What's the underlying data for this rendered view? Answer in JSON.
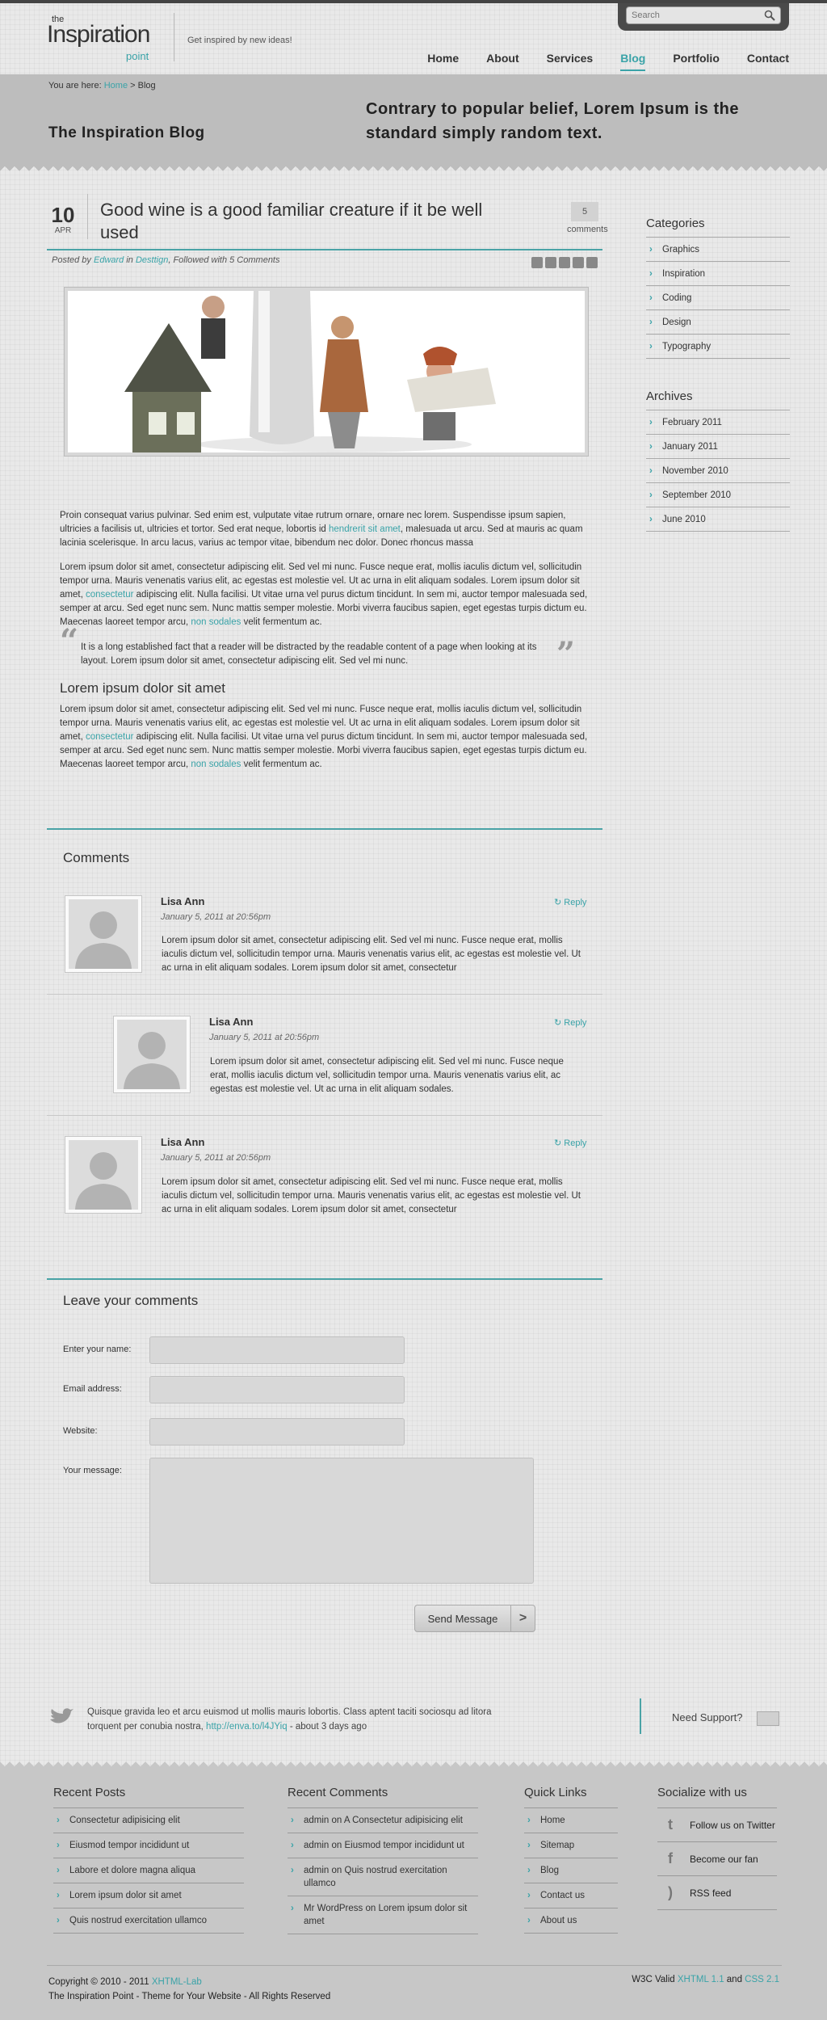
{
  "header": {
    "logo_the": "the",
    "logo_main": "Inspiration",
    "logo_point": "point",
    "tagline": "Get inspired by new ideas!",
    "search_placeholder": "Search",
    "nav": [
      "Home",
      "About",
      "Services",
      "Blog",
      "Portfolio",
      "Contact"
    ],
    "nav_active": "Blog"
  },
  "banner": {
    "breadcrumb_prefix": "You are here:",
    "breadcrumb_home": "Home",
    "breadcrumb_sep": ">",
    "breadcrumb_current": "Blog",
    "title": "The Inspiration Blog",
    "quote": "Contrary to popular belief, Lorem Ipsum is the standard simply random text."
  },
  "post": {
    "day": "10",
    "month": "APR",
    "title": "Good wine is a good familiar creature if it be well used",
    "comment_count": "5",
    "comment_label": "comments",
    "meta_posted_by": "Posted by",
    "meta_author": "Edward",
    "meta_in": "in",
    "meta_category": "Desttign",
    "meta_followed": ", Followed with 5 Comments",
    "p1_a": "Proin consequat varius pulvinar. Sed enim est, vulputate vitae rutrum ornare, ornare nec lorem. Suspendisse ipsum sapien, ultricies a facilisis ut, ultricies et tortor. Sed erat neque, lobortis id ",
    "p1_link": "hendrerit sit amet",
    "p1_b": ", malesuada ut arcu. Sed at mauris ac quam lacinia scelerisque. In arcu lacus, varius ac tempor vitae, bibendum nec dolor. Donec rhoncus massa",
    "p2_a": "Lorem ipsum dolor sit amet, consectetur adipiscing elit. Sed vel mi nunc. Fusce neque erat, mollis iaculis dictum vel, sollicitudin tempor urna. Mauris venenatis varius elit, ac egestas est molestie vel. Ut ac urna in elit aliquam sodales. Lorem ipsum dolor sit amet, ",
    "p2_link": "consectetur",
    "p2_b": " adipiscing elit. Nulla facilisi. Ut vitae urna vel purus dictum tincidunt. In sem mi, auctor tempor malesuada sed, semper at arcu. Sed eget nunc sem. Nunc mattis semper molestie. Morbi viverra faucibus sapien, eget egestas turpis dictum eu. Maecenas laoreet tempor arcu, ",
    "p2_link2": "non sodales",
    "p2_c": " velit fermentum ac.",
    "quote": "It is a long established fact that a reader will be distracted by the readable content of a page when looking at its layout. Lorem ipsum dolor sit amet, consectetur adipiscing elit. Sed vel mi nunc.",
    "subhead": "Lorem ipsum dolor sit amet",
    "p3_a": "Lorem ipsum dolor sit amet, consectetur adipiscing elit. Sed vel mi nunc. Fusce neque erat, mollis iaculis dictum vel, sollicitudin tempor urna. Mauris venenatis varius elit, ac egestas est molestie vel. Ut ac urna in elit aliquam sodales. Lorem ipsum dolor sit amet, ",
    "p3_link": "consectetur",
    "p3_b": " adipiscing elit. Nulla facilisi. Ut vitae urna vel purus dictum tincidunt. In sem mi, auctor tempor malesuada sed, semper at arcu. Sed eget nunc sem. Nunc mattis semper molestie. Morbi viverra faucibus sapien, eget egestas turpis dictum eu. Maecenas laoreet tempor arcu, ",
    "p3_link2": "non sodales",
    "p3_c": " velit fermentum ac."
  },
  "comments": {
    "title": "Comments",
    "reply_label": "Reply",
    "items": [
      {
        "name": "Lisa Ann",
        "date": "January 5, 2011 at 20:56pm",
        "text": "Lorem ipsum dolor sit amet, consectetur adipiscing elit. Sed vel mi nunc. Fusce neque erat, mollis iaculis dictum vel, sollicitudin tempor urna. Mauris venenatis varius elit, ac egestas est molestie vel. Ut ac urna in elit aliquam sodales. Lorem ipsum dolor sit amet, consectetur"
      },
      {
        "name": "Lisa Ann",
        "date": "January 5, 2011 at 20:56pm",
        "text": "Lorem ipsum dolor sit amet, consectetur adipiscing elit. Sed vel mi nunc. Fusce neque erat, mollis iaculis dictum vel, sollicitudin tempor urna. Mauris venenatis varius elit, ac egestas est molestie vel. Ut ac urna in elit aliquam sodales."
      },
      {
        "name": "Lisa Ann",
        "date": "January 5, 2011 at 20:56pm",
        "text": "Lorem ipsum dolor sit amet, consectetur adipiscing elit. Sed vel mi nunc. Fusce neque erat, mollis iaculis dictum vel, sollicitudin tempor urna. Mauris venenatis varius elit, ac egestas est molestie vel. Ut ac urna in elit aliquam sodales. Lorem ipsum dolor sit amet, consectetur"
      }
    ]
  },
  "form": {
    "title": "Leave your comments",
    "name_label": "Enter your name:",
    "email_label": "Email address:",
    "website_label": "Website:",
    "message_label": "Your message:",
    "send_label": "Send Message"
  },
  "sidebar": {
    "categories_title": "Categories",
    "categories": [
      "Graphics",
      "Inspiration",
      "Coding",
      "Design",
      "Typography"
    ],
    "archives_title": "Archives",
    "archives": [
      "February 2011",
      "January 2011",
      "November 2010",
      "September 2010",
      "June 2010"
    ]
  },
  "tweet": {
    "text_a": "Quisque gravida leo et arcu euismod ut mollis mauris lobortis. Class aptent taciti sociosqu ad litora torquent per conubia nostra, ",
    "link": "http://enva.to/l4JYiq",
    "text_b": " - about 3 days ago",
    "support": "Need Support?"
  },
  "footer": {
    "recent_posts_title": "Recent Posts",
    "recent_posts": [
      "Consectetur adipisicing  elit",
      "Eiusmod tempor incididunt ut",
      "Labore et dolore magna aliqua",
      "Lorem ipsum dolor sit amet",
      "Quis nostrud exercitation ullamco"
    ],
    "recent_comments_title": "Recent Comments",
    "recent_comments": [
      "admin on A Consectetur adipisicing  elit",
      "admin on Eiusmod tempor incididunt ut",
      "admin on Quis nostrud exercitation ullamco",
      "Mr WordPress on Lorem ipsum dolor sit amet"
    ],
    "quick_links_title": "Quick Links",
    "quick_links": [
      "Home",
      "Sitemap",
      "Blog",
      "Contact us",
      "About us"
    ],
    "social_title": "Socialize with us",
    "social": [
      "Follow us on Twitter",
      "Become our fan",
      "RSS feed"
    ],
    "copyright_a": "Copyright © 2010 - 2011 ",
    "copyright_link": "XHTML-Lab",
    "copyright_b": "The Inspiration Point - Theme for Your Website - All Rights Reserved",
    "w3c_a": "W3C Valid ",
    "w3c_xhtml": "XHTML 1.1",
    "w3c_and": " and ",
    "w3c_css": "CSS 2.1"
  },
  "colors": {
    "accent": "#3aa3a8",
    "banner": "#bdbdbd",
    "footer": "#c7c7c7"
  }
}
